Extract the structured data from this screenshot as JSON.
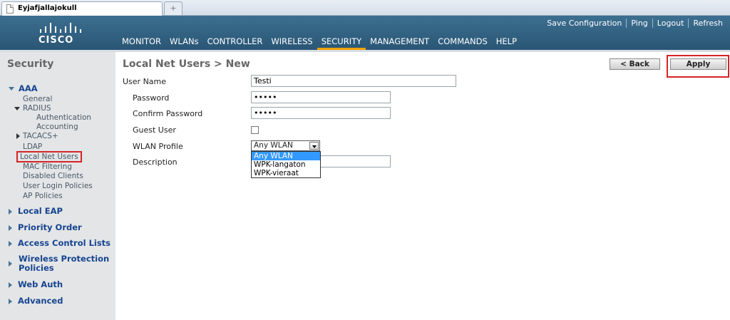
{
  "browser": {
    "tab_title": "Eyjafjallajokull",
    "new_tab_glyph": "+"
  },
  "header": {
    "logo_text": "CISCO",
    "top_links": [
      "Save Configuration",
      "Ping",
      "Logout",
      "Refresh"
    ],
    "nav": [
      "MONITOR",
      "WLANs",
      "CONTROLLER",
      "WIRELESS",
      "SECURITY",
      "MANAGEMENT",
      "COMMANDS",
      "HELP"
    ],
    "active_nav": "SECURITY",
    "active_color": "#f0a000"
  },
  "sidebar": {
    "title": "Security",
    "aaa": "AAA",
    "aaa_items": {
      "general": "General",
      "radius": "RADIUS",
      "authentication": "Authentication",
      "accounting": "Accounting",
      "tacacs": "TACACS+",
      "ldap": "LDAP",
      "local_net_users": "Local Net Users",
      "mac_filtering": "MAC Filtering",
      "disabled_clients": "Disabled Clients",
      "user_login_policies": "User Login Policies",
      "ap_policies": "AP Policies"
    },
    "sections": {
      "local_eap": "Local EAP",
      "priority_order": "Priority Order",
      "access_control_lists": "Access Control Lists",
      "wireless_protection_1": "Wireless Protection",
      "wireless_protection_2": "Policies",
      "web_auth": "Web Auth",
      "advanced": "Advanced"
    },
    "highlight_color": "#d42426"
  },
  "content": {
    "title": "Local Net Users > New",
    "back_label": "< Back",
    "apply_label": "Apply",
    "form": {
      "user_name_label": "User Name",
      "user_name_value": "Testi",
      "password_label": "Password",
      "password_value": "•••••",
      "confirm_label": "Confirm Password",
      "confirm_value": "•••••",
      "guest_label": "Guest User",
      "wlan_label": "WLAN Profile",
      "wlan_selected": "Any WLAN",
      "wlan_options": [
        "Any WLAN",
        "WPK-langaton",
        "WPK-vieraat"
      ],
      "description_label": "Description",
      "description_value": ""
    }
  }
}
